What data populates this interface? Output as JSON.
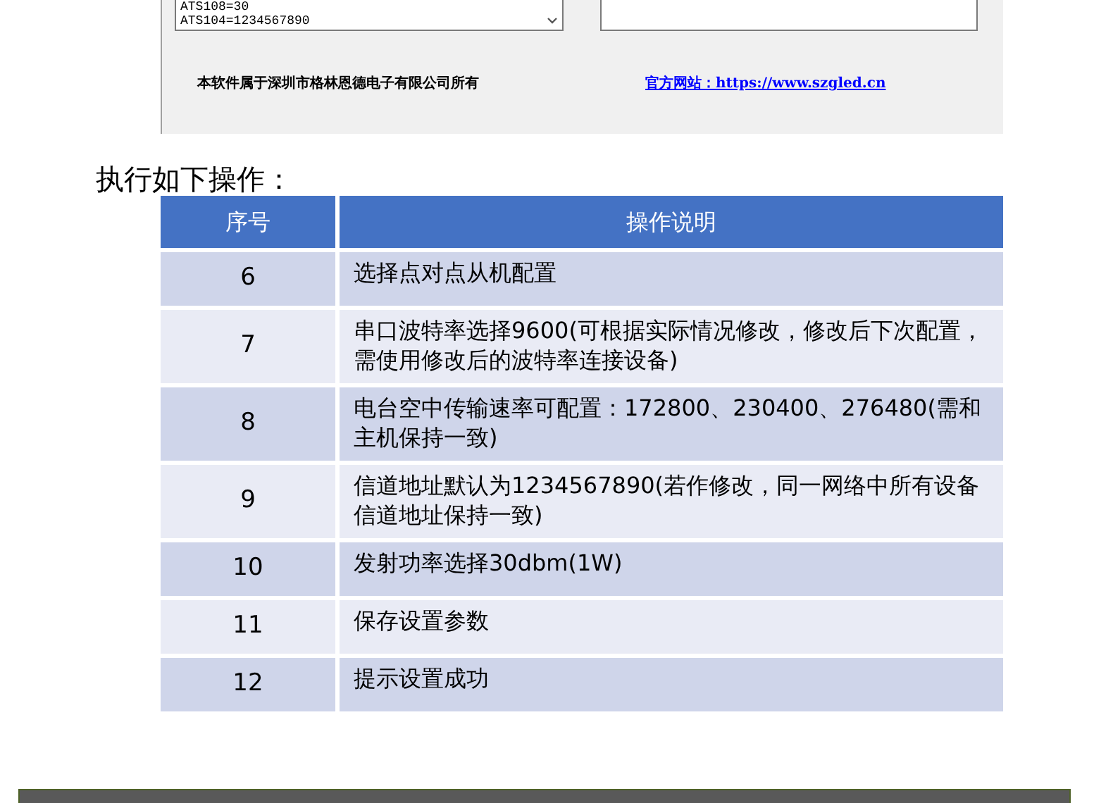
{
  "software_screenshot": {
    "log_lines": [
      "ATS108=30",
      "ATS104=1234567890"
    ],
    "copyright": "本软件属于深圳市格林恩德电子有限公司所有",
    "website_link": "官方网站：https://www.szgled.cn"
  },
  "intro": "执行如下操作：",
  "table": {
    "columns": [
      "序号",
      "操作说明"
    ],
    "rows": [
      {
        "number": "6",
        "description": "选择点对点从机配置"
      },
      {
        "number": "7",
        "description": "串口波特率选择9600(可根据实际情况修改，修改后下次配置，需使用修改后的波特率连接设备)"
      },
      {
        "number": "8",
        "description": "电台空中传输速率可配置：172800、230400、276480(需和主机保持一致)"
      },
      {
        "number": "9",
        "description": "信道地址默认为1234567890(若作修改，同一网络中所有设备信道地址保持一致)"
      },
      {
        "number": "10",
        "description": "发射功率选择30dbm(1W)"
      },
      {
        "number": "11",
        "description": "保存设置参数"
      },
      {
        "number": "12",
        "description": "提示设置成功"
      }
    ]
  }
}
